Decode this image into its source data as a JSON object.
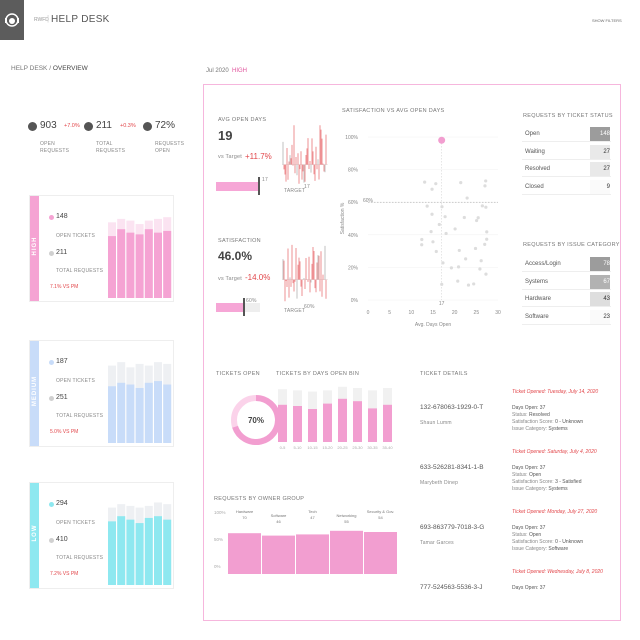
{
  "header": {
    "app_prefix": "RWFD",
    "title": "HELP DESK",
    "show_filters": "SHOW FILTERS"
  },
  "breadcrumb": {
    "parent": "HELP DESK",
    "separator": "/",
    "current": "OVERVIEW"
  },
  "filters": {
    "period": "Jul 2020",
    "priority": "HIGH"
  },
  "kpis": [
    {
      "value": "903",
      "delta": "+7.0%",
      "label": "OPEN REQUESTS",
      "icon": "dollar-icon"
    },
    {
      "value": "211",
      "delta": "+0.3%",
      "label": "TOTAL REQUESTS",
      "icon": "check-icon"
    },
    {
      "value": "72%",
      "delta": "",
      "label": "REQUESTS OPEN",
      "icon": "percent-icon"
    }
  ],
  "priority_cards": [
    {
      "name": "HIGH",
      "color": "#f5a3d3",
      "light": "#fbe3f1",
      "open": "148",
      "open_label": "OPEN TICKETS",
      "total": "211",
      "total_label": "TOTAL REQUESTS",
      "pm": "7.1% VS PM",
      "bars_open": [
        0.72,
        0.8,
        0.76,
        0.74,
        0.8,
        0.76,
        0.78
      ],
      "bars_total": [
        0.88,
        0.92,
        0.9,
        0.86,
        0.9,
        0.92,
        0.94
      ]
    },
    {
      "name": "MEDIUM",
      "color": "#c8dcf9",
      "light": "#eef0f3",
      "open": "187",
      "open_label": "OPEN TICKETS",
      "total": "251",
      "total_label": "TOTAL REQUESTS",
      "pm": "5.0% VS PM",
      "bars_open": [
        0.66,
        0.7,
        0.68,
        0.64,
        0.7,
        0.72,
        0.68
      ],
      "bars_total": [
        0.9,
        0.94,
        0.88,
        0.92,
        0.9,
        0.94,
        0.92
      ]
    },
    {
      "name": "LOW",
      "color": "#8ee8f0",
      "light": "#eef0f3",
      "open": "294",
      "open_label": "OPEN TICKETS",
      "total": "410",
      "total_label": "TOTAL REQUESTS",
      "pm": "7.2% VS PM",
      "bars_open": [
        0.74,
        0.8,
        0.76,
        0.72,
        0.78,
        0.8,
        0.76
      ],
      "bars_total": [
        0.9,
        0.94,
        0.92,
        0.9,
        0.92,
        0.96,
        0.94
      ]
    }
  ],
  "avg_open_days": {
    "title": "AVG OPEN DAYS",
    "value": "19",
    "vs_label": "vs Target",
    "vs_value": "+11.7%",
    "bar_end": "17",
    "target_label": "TARGET",
    "target_value": "17"
  },
  "satisfaction": {
    "title": "SATISFACTION",
    "value": "46.0%",
    "vs_label": "vs Target",
    "vs_value": "-14.0%",
    "bar_end": "60%",
    "target_label": "TARGET",
    "target_value": "60%"
  },
  "scatter": {
    "title": "SATISFACTION VS AVG OPEN DAYS",
    "ylabel": "Satisfaction %",
    "xlabel": "Avg. Days Open",
    "y_ticks": [
      "100%",
      "80%",
      "60%",
      "40%",
      "20%",
      "0%"
    ],
    "x_ticks": [
      "0",
      "5",
      "10",
      "15",
      "20",
      "25",
      "30"
    ],
    "target_label": "60%",
    "marker_label": "17"
  },
  "requests_by_status": {
    "title": "REQUESTS BY TICKET STATUS",
    "rows": [
      {
        "label": "Open",
        "value": "148",
        "shade": 0.9
      },
      {
        "label": "Waiting",
        "value": "27",
        "shade": 0.2
      },
      {
        "label": "Resolved",
        "value": "27",
        "shade": 0.2
      },
      {
        "label": "Closed",
        "value": "9",
        "shade": 0.05
      }
    ]
  },
  "requests_by_issue": {
    "title": "REQUESTS BY ISSUE CATEGORY",
    "rows": [
      {
        "label": "Access/Login",
        "value": "78",
        "shade": 0.9
      },
      {
        "label": "Systems",
        "value": "67",
        "shade": 0.7
      },
      {
        "label": "Hardware",
        "value": "43",
        "shade": 0.3
      },
      {
        "label": "Software",
        "value": "23",
        "shade": 0.05
      }
    ]
  },
  "tickets_open": {
    "title": "TICKETS OPEN",
    "value": "70%",
    "fraction": 0.7
  },
  "tickets_by_bin": {
    "title": "TICKETS BY DAYS OPEN BIN",
    "categories": [
      "0-5",
      "5-10",
      "10-15",
      "15-20",
      "20-25",
      "25-30",
      "30-35",
      "35-40"
    ],
    "open": [
      0.62,
      0.6,
      0.55,
      0.64,
      0.72,
      0.68,
      0.56,
      0.62
    ],
    "total": [
      0.88,
      0.86,
      0.84,
      0.86,
      0.92,
      0.9,
      0.86,
      0.9
    ]
  },
  "owner_group": {
    "title": "REQUESTS BY OWNER GROUP",
    "y_ticks": [
      "100%",
      "50%",
      "0%"
    ],
    "groups": [
      {
        "name": "Hardware",
        "value": "70"
      },
      {
        "name": "Software",
        "value": "46"
      },
      {
        "name": "Tech",
        "value": "47"
      },
      {
        "name": "Networking",
        "value": "55"
      },
      {
        "name": "Security & Gov.",
        "value": "54"
      }
    ],
    "heights": [
      0.68,
      0.64,
      0.66,
      0.72,
      0.7
    ]
  },
  "ticket_details": {
    "title": "TICKET DETAILS",
    "tickets": [
      {
        "id": "132-678063-1929-0-T",
        "name": "Shaun Lumm",
        "opened": "Ticket Opened: Tuesday, July 14, 2020",
        "days": "Days Open: 37",
        "status_label": "Status:",
        "status": "Resolved",
        "score_label": "Satisfaction Score:",
        "score": "0 - Unknown",
        "cat_label": "Issue Category:",
        "category": "Systems"
      },
      {
        "id": "633-526281-8341-1-B",
        "name": "Marybeth Dinep",
        "opened": "Ticket Opened: Saturday, July 4, 2020",
        "days": "Days Open: 37",
        "status_label": "Status:",
        "status": "Open",
        "score_label": "Satisfaction Score:",
        "score": "3 - Satisfied",
        "cat_label": "Issue Category:",
        "category": "Systems"
      },
      {
        "id": "693-863779-7018-3-G",
        "name": "Tamar Garces",
        "opened": "Ticket Opened: Monday, July 27, 2020",
        "days": "Days Open: 37",
        "status_label": "Status:",
        "status": "Open",
        "score_label": "Satisfaction Score:",
        "score": "0 - Unknown",
        "cat_label": "Issue Category:",
        "category": "Software"
      },
      {
        "id": "777-524563-5536-3-J",
        "name": "",
        "opened": "Ticket Opened: Wednesday, July 8, 2020",
        "days": "Days Open: 37",
        "status_label": "",
        "status": "",
        "score_label": "",
        "score": "",
        "cat_label": "",
        "category": ""
      }
    ]
  }
}
